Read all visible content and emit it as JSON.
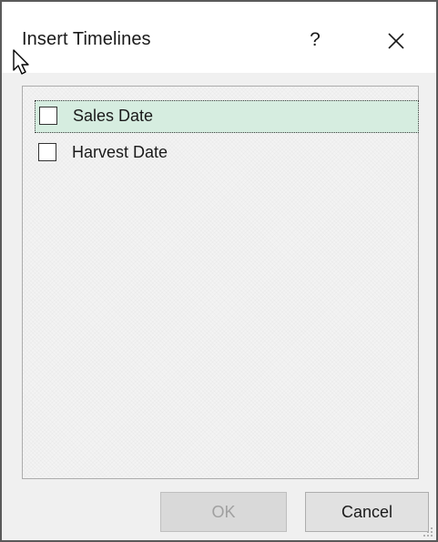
{
  "dialog": {
    "title": "Insert Timelines",
    "help_label": "?",
    "close_icon": "close-icon"
  },
  "list": {
    "items": [
      {
        "label": "Sales Date",
        "checked": false,
        "selected": true
      },
      {
        "label": "Harvest Date",
        "checked": false,
        "selected": false
      }
    ]
  },
  "buttons": {
    "ok_label": "OK",
    "ok_enabled": false,
    "cancel_label": "Cancel"
  },
  "colors": {
    "selection_bg": "#d6ede0",
    "dialog_bg": "#f0f0f0",
    "disabled_text": "#a0a0a0"
  }
}
